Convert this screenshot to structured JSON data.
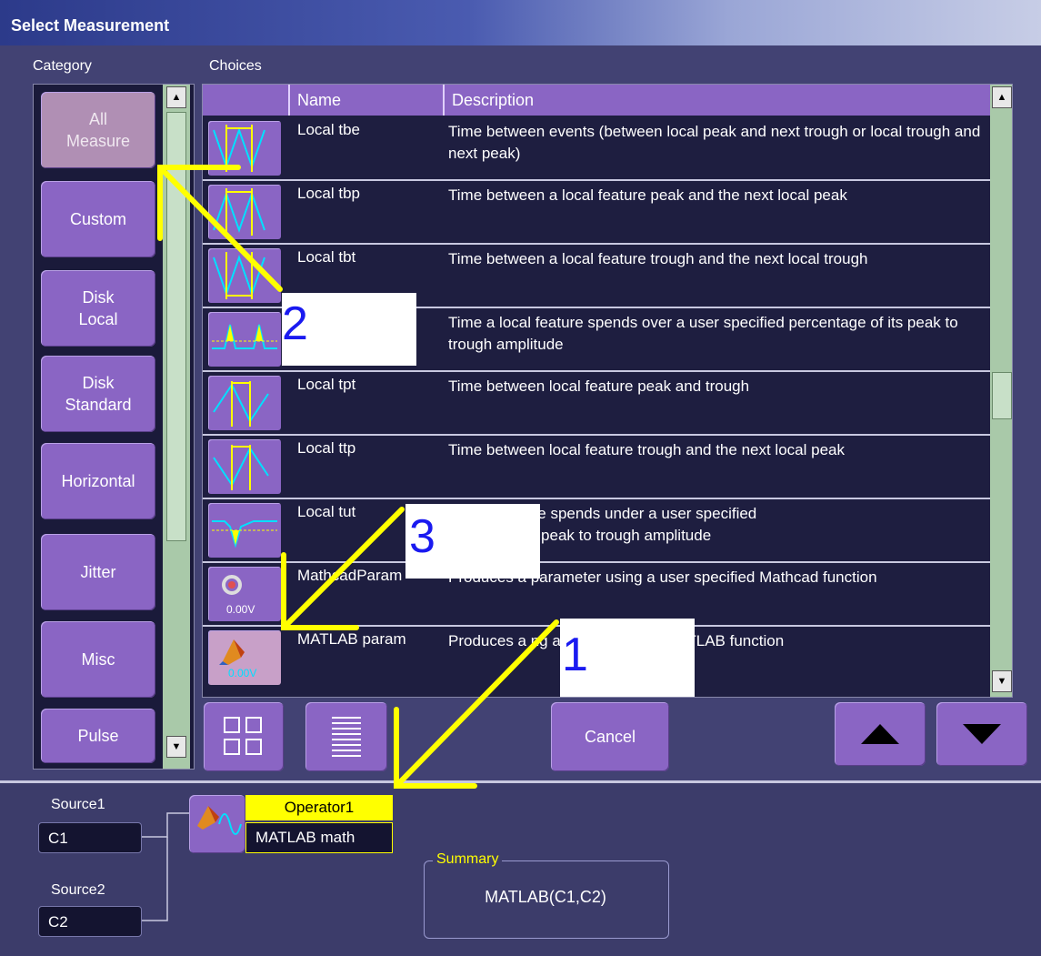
{
  "window": {
    "title": "Select Measurement"
  },
  "labels": {
    "category": "Category",
    "choices": "Choices"
  },
  "categories": [
    {
      "label": "All\nMeasure",
      "active": true
    },
    {
      "label": "Custom"
    },
    {
      "label": "Disk\nLocal"
    },
    {
      "label": "Disk\nStandard"
    },
    {
      "label": "Horizontal"
    },
    {
      "label": "Jitter"
    },
    {
      "label": "Misc"
    },
    {
      "label": "Pulse"
    }
  ],
  "table": {
    "headers": {
      "name": "Name",
      "description": "Description"
    },
    "rows": [
      {
        "name": "Local tbe",
        "description": "Time between events (between local peak and next trough or local  trough and next peak)",
        "icon": "tbe-icon"
      },
      {
        "name": "Local tbp",
        "description": "Time between a local feature peak and the next local peak",
        "icon": "tbp-icon"
      },
      {
        "name": "Local tbt",
        "description": "Time between a local feature trough and the next local trough",
        "icon": "tbt-icon"
      },
      {
        "name": "",
        "description": "Time a local feature spends over a user specified percentage of its peak to trough amplitude",
        "icon": "tot-icon"
      },
      {
        "name": "Local tpt",
        "description": "Time between local feature peak and trough",
        "icon": "tpt-icon"
      },
      {
        "name": "Local ttp",
        "description": "Time between local feature trough and the next local peak",
        "icon": "ttp-icon"
      },
      {
        "name": "Local tut",
        "description": "      cal feature spends under a user specified\n          e of its peak to trough amplitude",
        "icon": "tut-icon"
      },
      {
        "name": "MathcadParam",
        "description": "Produces a parameter using a user specified Mathcad function",
        "icon": "mathcad-icon",
        "icon_label": "0.00V"
      },
      {
        "name": "MATLAB param",
        "description": "Produces a            ng a user specified MATLAB function",
        "icon": "matlab-icon",
        "icon_label": "0.00V"
      }
    ]
  },
  "buttons": {
    "cancel": "Cancel"
  },
  "operator": {
    "source1_label": "Source1",
    "source1_value": "C1",
    "source2_label": "Source2",
    "source2_value": "C2",
    "operator_label": "Operator1",
    "operator_value": "MATLAB math",
    "summary_label": "Summary",
    "summary_value": "MATLAB(C1,C2)"
  },
  "annotations": {
    "one": "1",
    "two": "2",
    "three": "3"
  },
  "colors": {
    "annotation_arrow": "#ffff00",
    "annotation_number": "#1a1af0",
    "button": "#8a65c4",
    "panel": "#424273"
  }
}
